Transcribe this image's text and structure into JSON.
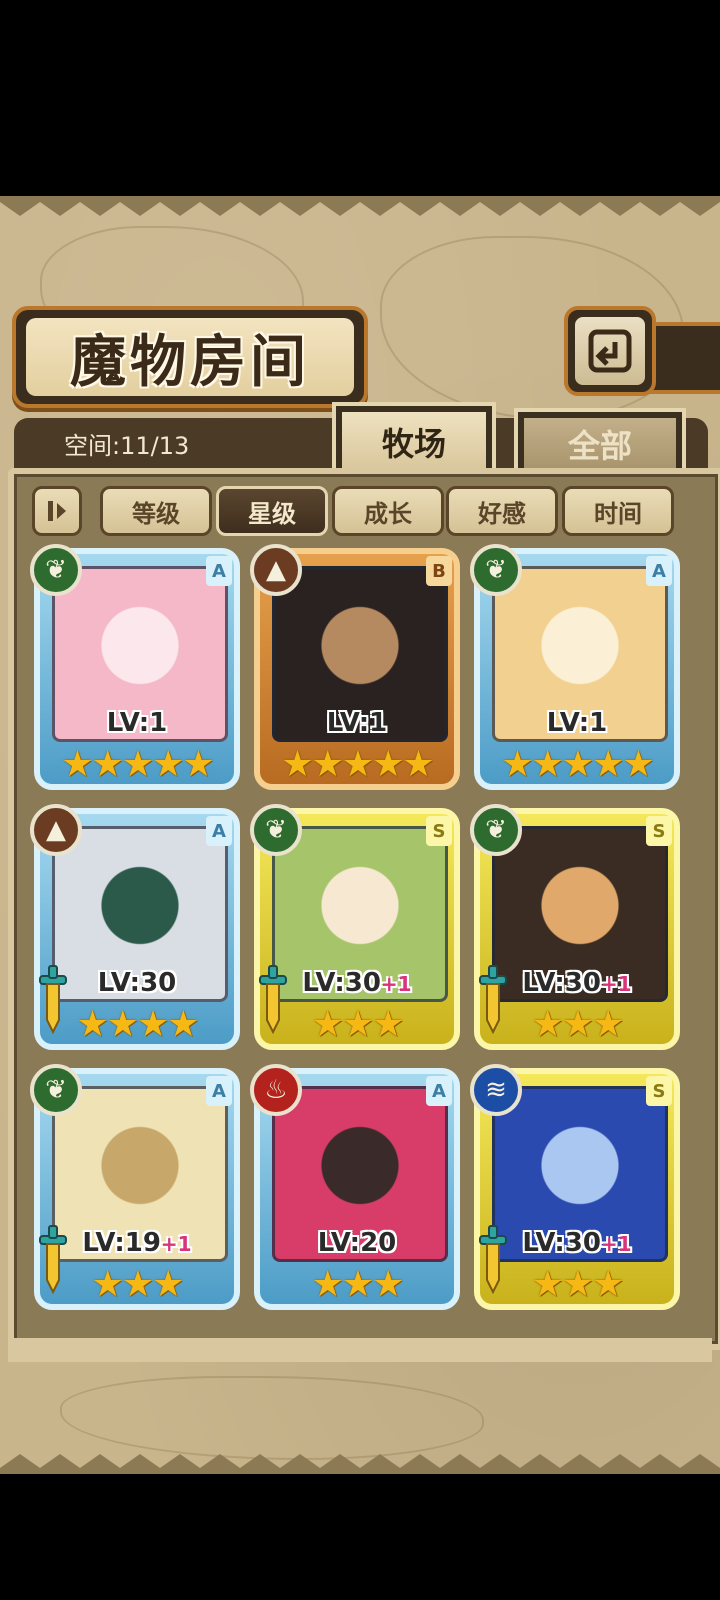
{
  "title": "魔物房间",
  "space": "空间:11/13",
  "tabs": [
    {
      "label": "牧场",
      "active": true
    },
    {
      "label": "全部",
      "active": false
    }
  ],
  "sort_buttons": [
    {
      "label": "等级",
      "active": false
    },
    {
      "label": "星级",
      "active": true
    },
    {
      "label": "成长",
      "active": false
    },
    {
      "label": "好感",
      "active": false
    },
    {
      "label": "时间",
      "active": false
    }
  ],
  "monsters": [
    {
      "attribute": "leaf-icon",
      "rank": "A",
      "level": "LV:1",
      "plus": "",
      "stars": "★★★★★",
      "sword": false,
      "portrait_colors": [
        "#f4b8c8",
        "#fbe7ec"
      ]
    },
    {
      "attribute": "earth-icon",
      "rank": "B",
      "level": "LV:1",
      "plus": "",
      "stars": "★★★★★",
      "sword": false,
      "portrait_colors": [
        "#2a2220",
        "#b58a61"
      ]
    },
    {
      "attribute": "leaf-icon",
      "rank": "A",
      "level": "LV:1",
      "plus": "",
      "stars": "★★★★★",
      "sword": false,
      "portrait_colors": [
        "#f2d08f",
        "#fbf0d6"
      ]
    },
    {
      "attribute": "earth-icon",
      "rank": "A",
      "level": "LV:30",
      "plus": "",
      "stars": "★★★★",
      "sword": true,
      "portrait_colors": [
        "#d9dee4",
        "#2c5a4a"
      ]
    },
    {
      "attribute": "leaf-icon",
      "rank": "S",
      "level": "LV:30",
      "plus": "+1",
      "stars": "★★★",
      "sword": true,
      "portrait_colors": [
        "#a6c46a",
        "#f7e8d2"
      ]
    },
    {
      "attribute": "leaf-icon",
      "rank": "S",
      "level": "LV:30",
      "plus": "+1",
      "stars": "★★★",
      "sword": true,
      "portrait_colors": [
        "#3a2c22",
        "#e0a86a"
      ]
    },
    {
      "attribute": "leaf-icon",
      "rank": "A",
      "level": "LV:19",
      "plus": "+1",
      "stars": "★★★",
      "sword": true,
      "portrait_colors": [
        "#efe2b4",
        "#c8a86a"
      ]
    },
    {
      "attribute": "fire-icon",
      "rank": "A",
      "level": "LV:20",
      "plus": "",
      "stars": "★★★",
      "sword": false,
      "portrait_colors": [
        "#d83d6a",
        "#3a2a2a"
      ]
    },
    {
      "attribute": "water-icon",
      "rank": "S",
      "level": "LV:30",
      "plus": "+1",
      "stars": "★★★",
      "sword": true,
      "portrait_colors": [
        "#2a4ab0",
        "#a9c7f0"
      ]
    }
  ]
}
